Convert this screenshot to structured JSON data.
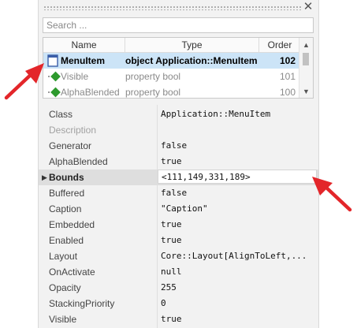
{
  "search": {
    "placeholder": "Search ..."
  },
  "close_glyph": "✕",
  "tree": {
    "columns": [
      "Name",
      "Type",
      "Order"
    ],
    "rows": [
      {
        "name": "MenuItem",
        "type": "object Application::MenuItem",
        "order": "102",
        "icon": "object-icon",
        "selected": true
      },
      {
        "name": "Visible",
        "type": "property bool",
        "order": "101",
        "icon": "property-icon"
      },
      {
        "name": "AlphaBlended",
        "type": "property bool",
        "order": "100",
        "icon": "property-icon"
      }
    ],
    "scroll_up": "▲",
    "scroll_down": "▼"
  },
  "properties": [
    {
      "label": "Class",
      "value": "Application::MenuItem"
    },
    {
      "label": "Description",
      "value": "",
      "disabled": true
    },
    {
      "label": "Generator",
      "value": "false"
    },
    {
      "label": "AlphaBlended",
      "value": "true"
    },
    {
      "label": "Bounds",
      "value": "<111,149,331,189>",
      "expandable": true,
      "expander": "▶"
    },
    {
      "label": "Buffered",
      "value": "false"
    },
    {
      "label": "Caption",
      "value": "\"Caption\""
    },
    {
      "label": "Embedded",
      "value": "true"
    },
    {
      "label": "Enabled",
      "value": "true"
    },
    {
      "label": "Layout",
      "value": "Core::Layout[AlignToLeft,..."
    },
    {
      "label": "OnActivate",
      "value": "null"
    },
    {
      "label": "Opacity",
      "value": "255"
    },
    {
      "label": "StackingPriority",
      "value": "0"
    },
    {
      "label": "Visible",
      "value": "true"
    }
  ],
  "colors": {
    "annotation_arrow": "#e3262a",
    "selection": "#cce4f7",
    "property_icon": "#2e9a2e"
  }
}
